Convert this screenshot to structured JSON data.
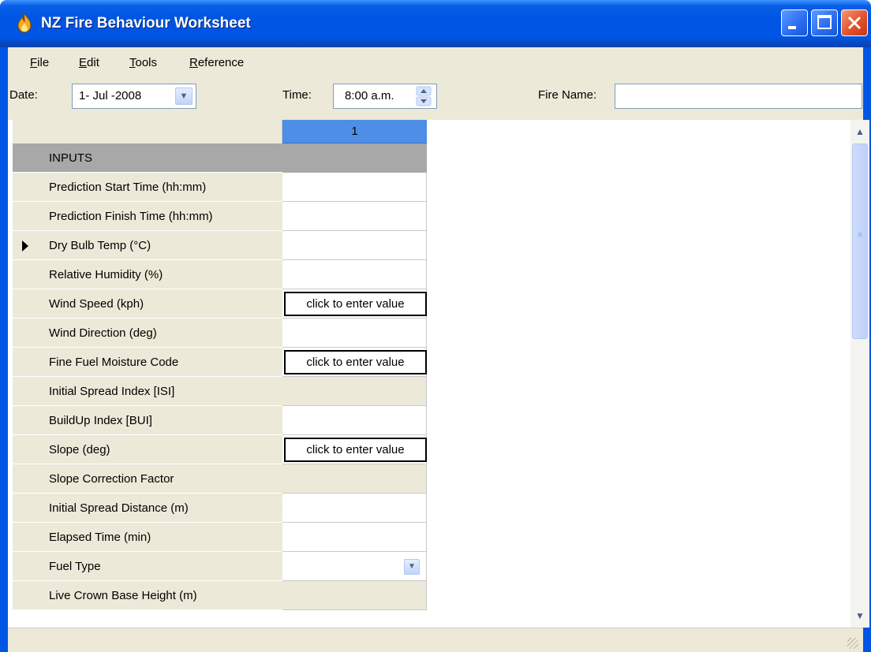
{
  "window": {
    "title": "NZ Fire Behaviour Worksheet"
  },
  "menu": {
    "items": [
      {
        "label": "File",
        "accel": "F",
        "rest": "ile"
      },
      {
        "label": "Edit",
        "accel": "E",
        "rest": "dit"
      },
      {
        "label": "Tools",
        "accel": "T",
        "rest": "ools"
      },
      {
        "label": "Reference",
        "accel": "R",
        "rest": "eference"
      }
    ]
  },
  "toolbar": {
    "date_label": "Date:",
    "date_value": "1- Jul -2008",
    "time_label": "Time:",
    "time_value": "8:00 a.m.",
    "fire_name_label": "Fire Name:",
    "fire_name_value": ""
  },
  "grid": {
    "column_header": "1",
    "section_label": "INPUTS",
    "rows": [
      {
        "label": "Prediction Start Time (hh:mm)",
        "value": ""
      },
      {
        "label": "Prediction Finish Time (hh:mm)",
        "value": ""
      },
      {
        "label": "Dry Bulb Temp (°C)",
        "value": ""
      },
      {
        "label": "Relative Humidity (%)",
        "value": ""
      },
      {
        "label": "Wind Speed (kph)",
        "value": "click to enter value"
      },
      {
        "label": "Wind Direction (deg)",
        "value": ""
      },
      {
        "label": "Fine Fuel Moisture Code",
        "value": "click to enter value"
      },
      {
        "label": "Initial Spread Index [ISI]",
        "value": ""
      },
      {
        "label": "BuildUp Index [BUI]",
        "value": ""
      },
      {
        "label": "Slope (deg)",
        "value": "click to enter value"
      },
      {
        "label": "Slope Correction Factor",
        "value": ""
      },
      {
        "label": "Initial Spread Distance (m)",
        "value": ""
      },
      {
        "label": "Elapsed Time (min)",
        "value": ""
      },
      {
        "label": "Fuel Type",
        "value": ""
      },
      {
        "label": "Live Crown Base Height (m)",
        "value": ""
      }
    ]
  },
  "colors": {
    "titlebar": "#0055e5",
    "chrome": "#ece9d8",
    "column_header": "#4e8ee6",
    "section": "#a8a8a8"
  }
}
